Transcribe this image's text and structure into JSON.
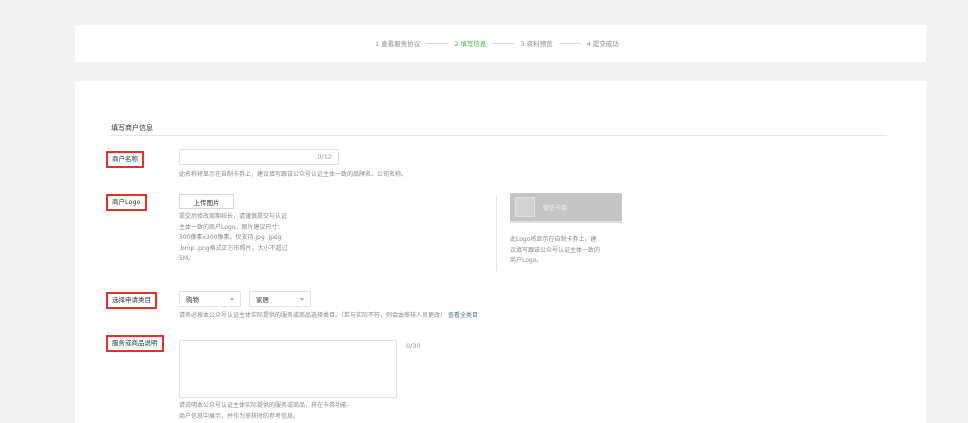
{
  "steps": [
    {
      "label": "1 查看服务协议",
      "active": false
    },
    {
      "label": "2 填写信息",
      "active": true
    },
    {
      "label": "3 资料预览",
      "active": false
    },
    {
      "label": "4 提交成功",
      "active": false
    }
  ],
  "colors": {
    "accent": "#44b549",
    "highlight": "#e5322d",
    "link": "#576b95"
  },
  "form": {
    "section_title": "填写商户信息",
    "merchant_name": {
      "label": "商户名称",
      "value": "",
      "counter": "0/12",
      "hint": "此名称将显示在自制卡券上，建议填写跟该公众号认证主体一致的品牌名、公司名称。"
    },
    "merchant_logo": {
      "label": "商户Logo",
      "upload_label": "上传图片",
      "hint_lines": [
        "提交后修改周期较长，请谨慎提交与认证",
        "主体一致的商户Logo。图片建议尺寸：",
        "300像素x300像素。仅支持.jpg .jpeg",
        ".bmp .png格式正方形照片，大小不超过",
        "5M。"
      ],
      "preview_name": "微信卡券",
      "preview_hint_lines": [
        "此Logo将显示在自制卡券上，建",
        "议填写跟该公众号认证主体一致的",
        "商户Logo。"
      ]
    },
    "category": {
      "label": "选择申请类目",
      "primary": "购物",
      "secondary": "家居",
      "hint": "请务必按本公众号认证主体实际提供的服务或商品选择类目。（若与实际不符，则会由审核人员更改）",
      "link": "查看全类目"
    },
    "description": {
      "label": "服务或商品说明",
      "value": "",
      "counter": "0/30",
      "hint_lines": [
        "请说明本公众号认证主体实际提供的服务或商品，将在卡券功能-",
        "商户信息中展示，并作为审核时的参考信息。"
      ]
    }
  }
}
